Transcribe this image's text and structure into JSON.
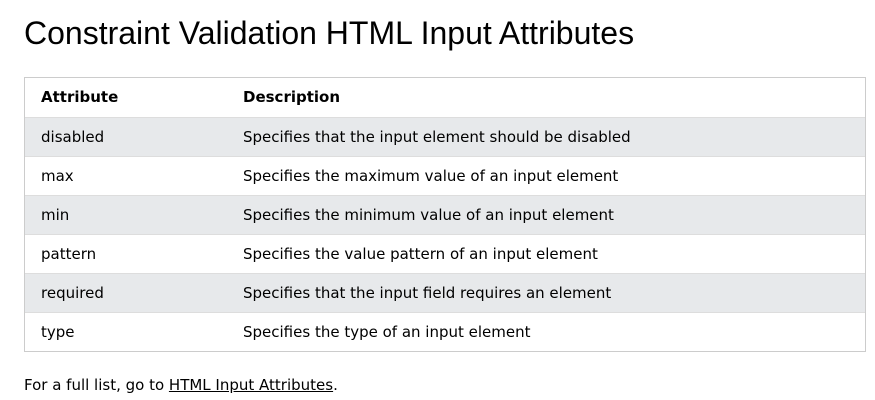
{
  "page": {
    "title": "Constraint Validation HTML Input Attributes"
  },
  "table": {
    "headers": {
      "attribute": "Attribute",
      "description": "Description"
    },
    "rows": [
      {
        "attribute": "disabled",
        "description": "Specifies that the input element should be disabled"
      },
      {
        "attribute": "max",
        "description": "Specifies the maximum value of an input element"
      },
      {
        "attribute": "min",
        "description": "Specifies the minimum value of an input element"
      },
      {
        "attribute": "pattern",
        "description": "Specifies the value pattern of an input element"
      },
      {
        "attribute": "required",
        "description": "Specifies that the input field requires an element"
      },
      {
        "attribute": "type",
        "description": "Specifies the type of an input element"
      }
    ]
  },
  "footer": {
    "prefix": "For a full list, go to ",
    "link_text": "HTML Input Attributes",
    "suffix": "."
  },
  "colors": {
    "stripe": "#e7e9eb",
    "border": "#cccccc"
  }
}
